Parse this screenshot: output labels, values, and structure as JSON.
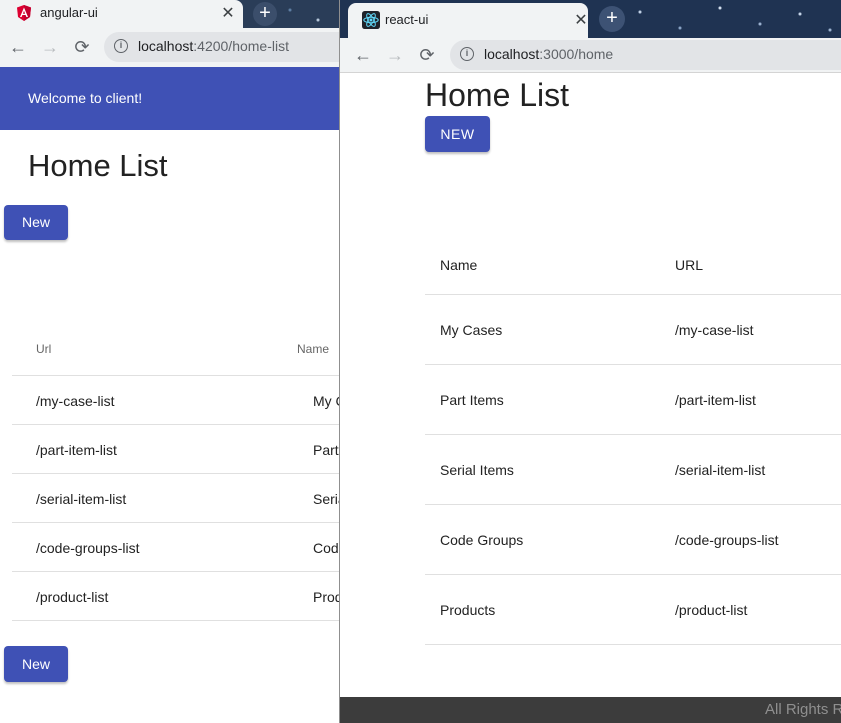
{
  "left_window": {
    "tab_title": "angular-ui",
    "tab_close": "✕",
    "new_tab": "+",
    "nav": {
      "back": "←",
      "forward": "→",
      "reload": "⟳"
    },
    "address": {
      "host": "localhost",
      "path": ":4200/home-list"
    },
    "toolbar_title": "Welcome to client!",
    "heading": "Home List",
    "new_button_top": "New",
    "new_button_bottom": "New",
    "table": {
      "headers": [
        "Url",
        "Name"
      ],
      "rows": [
        [
          "/my-case-list",
          "My Cases"
        ],
        [
          "/part-item-list",
          "Part Items"
        ],
        [
          "/serial-item-list",
          "Serial Items"
        ],
        [
          "/code-groups-list",
          "Code Groups"
        ],
        [
          "/product-list",
          "Products"
        ]
      ]
    }
  },
  "right_window": {
    "tab_title": "react-ui",
    "tab_close": "✕",
    "new_tab": "+",
    "nav": {
      "back": "←",
      "forward": "→",
      "reload": "⟳"
    },
    "address": {
      "host": "localhost",
      "path": ":3000/home"
    },
    "heading": "Home List",
    "new_button": "NEW",
    "table": {
      "headers": [
        "Name",
        "URL"
      ],
      "rows": [
        [
          "My Cases",
          "/my-case-list"
        ],
        [
          "Part Items",
          "/part-item-list"
        ],
        [
          "Serial Items",
          "/serial-item-list"
        ],
        [
          "Code Groups",
          "/code-groups-list"
        ],
        [
          "Products",
          "/product-list"
        ]
      ]
    },
    "footer": "All Rights R"
  },
  "colors": {
    "primary": "#3f51b5",
    "footer": "#3c3c3c"
  }
}
